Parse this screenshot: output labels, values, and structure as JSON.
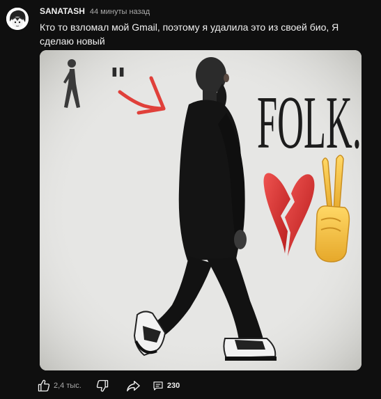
{
  "post": {
    "author": "SANATASH",
    "timestamp": "44 минуты назад",
    "text": "Кто то взломал мой Gmail, поэтому я удалила это из своей био, Я сделаю новый",
    "image": {
      "overlay_text": "FOLK.",
      "quote_mark": "\"",
      "emojis": [
        "walking-person",
        "broken-heart",
        "victory-hand"
      ],
      "arrow_color": "#e0403a"
    }
  },
  "actions": {
    "like_count": "2,4 тыс.",
    "comment_count": "230"
  },
  "colors": {
    "background": "#0f0f0f",
    "text_primary": "#f1f1f1",
    "text_secondary": "#aaaaaa",
    "heart": "#d32f2f",
    "hand": "#f4c148"
  }
}
